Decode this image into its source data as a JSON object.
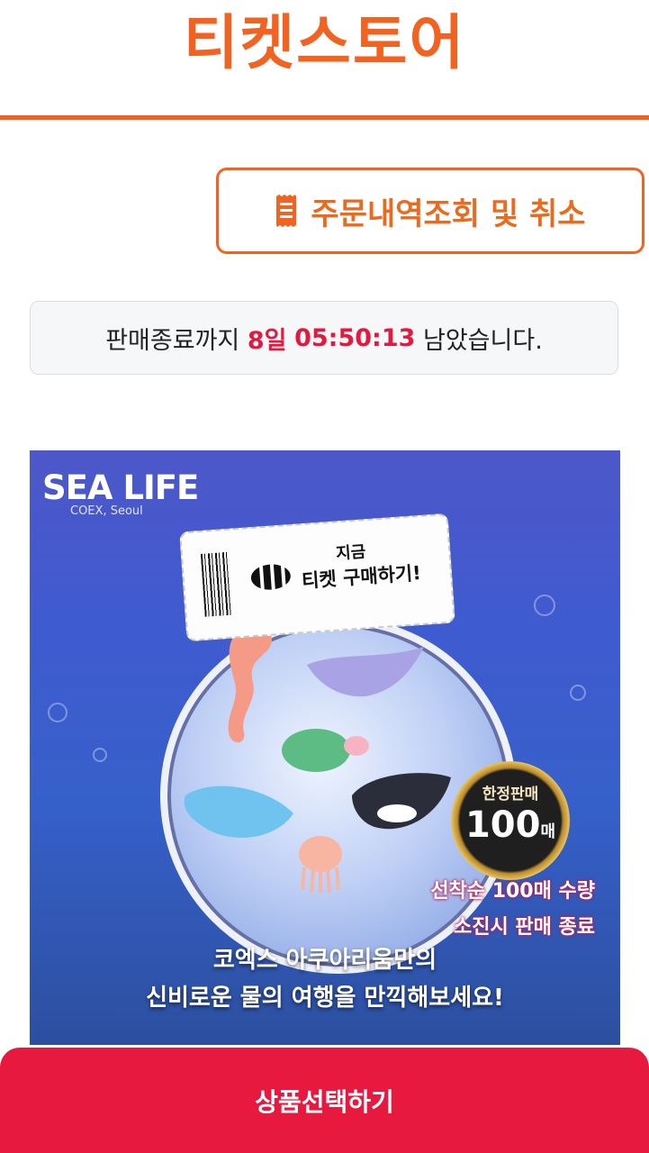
{
  "header": {
    "title": "티켓스토어"
  },
  "order_button": {
    "label": "주문내역조회 및 취소"
  },
  "countdown": {
    "prefix": "판매종료까지",
    "days": "8일",
    "time": "05:50:13",
    "suffix": "남았습니다."
  },
  "banner": {
    "logo": "SEA LIFE",
    "logo_sub": "COEX, Seoul",
    "ticket_top": "지금",
    "ticket_main": "티켓 구매하기!",
    "badge_top": "한정판매",
    "badge_number": "100",
    "badge_unit": "매",
    "limit_line1": "선착순 100매 수량",
    "limit_line2": "소진시 판매 종료",
    "caption_line1": "코엑스 아쿠아리움만의",
    "caption_line2": "신비로운 물의 여행을 만끽해보세요!"
  },
  "bottom_button": {
    "label": "상품선택하기"
  },
  "colors": {
    "brand_orange": "#f26322",
    "accent_red": "#e8193e"
  }
}
